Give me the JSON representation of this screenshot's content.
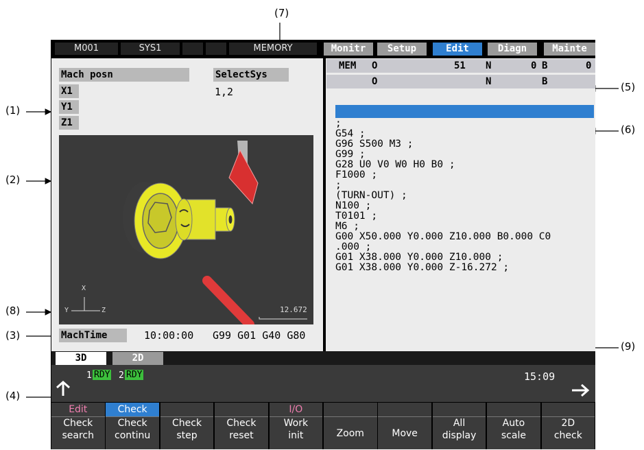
{
  "callouts": [
    "(1)",
    "(2)",
    "(3)",
    "(4)",
    "(5)",
    "(6)",
    "(7)",
    "(8)",
    "(9)"
  ],
  "topbar": {
    "machine": "M001",
    "system": "SYS1",
    "mode": "MEMORY"
  },
  "tabs": [
    "Monitr",
    "Setup",
    "Edit",
    "Diagn",
    "Mainte"
  ],
  "active_tab": "Edit",
  "left": {
    "mach_posn": "Mach posn",
    "axes": [
      "X1",
      "Y1",
      "Z1"
    ],
    "select_sys": "SelectSys",
    "select_sys_value": "1,2",
    "axis_triad": {
      "x": "X",
      "y": "Y",
      "z": "Z"
    },
    "scale_value": "12.672",
    "mach_time_label": "MachTime",
    "mach_time_value": "10:00:00",
    "modal_codes": "G99 G01 G40 G80"
  },
  "right": {
    "mode": "MEM",
    "row1": {
      "o_label": "O",
      "o_value": "51",
      "n_label": "N",
      "n_value": "0",
      "b_label": "B",
      "b_value": "0"
    },
    "row2": {
      "o_label": "O",
      "n_label": "N",
      "b_label": "B"
    },
    "program_lines": [
      ";",
      "G54 ;",
      "G96 S500 M3 ;",
      "G99 ;",
      "G28 U0 V0 W0 H0 B0 ;",
      "F1000 ;",
      ";",
      "(TURN-OUT) ;",
      "N100 ;",
      "T0101 ;",
      "M6 ;",
      "G00 X50.000 Y0.000 Z10.000 B0.000 C0",
      ".000 ;",
      "G01 X38.000 Y0.000 Z10.000 ;",
      "G01 X38.000 Y0.000 Z-16.272 ;"
    ]
  },
  "view_tabs": [
    "3D",
    "2D"
  ],
  "status": {
    "rdy1_num": "1",
    "rdy1": "RDY",
    "rdy2_num": "2",
    "rdy2": "RDY",
    "clock": "15:09"
  },
  "softkeys": [
    {
      "top": "Edit",
      "l1": "Check",
      "l2": "search"
    },
    {
      "top": "Check",
      "l1": "Check",
      "l2": "continu"
    },
    {
      "top": "",
      "l1": "Check",
      "l2": "step"
    },
    {
      "top": "",
      "l1": "Check",
      "l2": "reset"
    },
    {
      "top": "I/O",
      "l1": "Work",
      "l2": "init"
    },
    {
      "top": "",
      "l1": "Zoom",
      "l2": ""
    },
    {
      "top": "",
      "l1": "Move",
      "l2": ""
    },
    {
      "top": "",
      "l1": "All",
      "l2": "display"
    },
    {
      "top": "",
      "l1": "Auto",
      "l2": "scale"
    },
    {
      "top": "",
      "l1": "2D",
      "l2": "check"
    }
  ],
  "colors": {
    "active_tab": "#2f7fd0",
    "rdy": "#3cbf3c",
    "edit_label": "#f07fb0",
    "check_label": "#2f7fd0",
    "io_label": "#f07fb0"
  }
}
